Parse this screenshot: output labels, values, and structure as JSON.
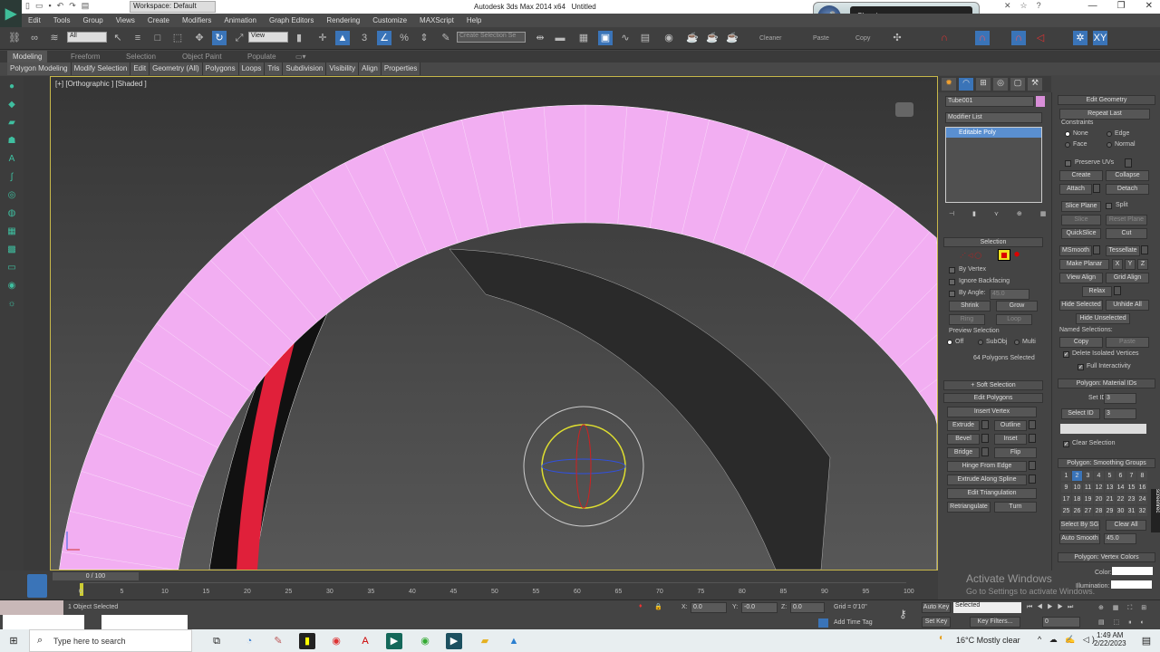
{
  "title_bar": {
    "app_title": "Autodesk 3ds Max  2014 x64",
    "doc": "Untitled",
    "workspace": "Workspace: Default"
  },
  "speech": {
    "status": "Sleeping"
  },
  "menu": [
    "Edit",
    "Tools",
    "Group",
    "Views",
    "Create",
    "Modifiers",
    "Animation",
    "Graph Editors",
    "Rendering",
    "Customize",
    "MAXScript",
    "Help"
  ],
  "toolbar": {
    "filter": "All",
    "ref_coord": "View",
    "snap_angle": "3",
    "named_sel": "Create Selection Se",
    "cleaner": "Cleaner",
    "paste": "Paste",
    "copy": "Copy"
  },
  "ribbon_tabs": [
    "Modeling",
    "Freeform",
    "Selection",
    "Object Paint",
    "Populate"
  ],
  "ribbon_items": [
    "Polygon Modeling",
    "Modify Selection",
    "Edit",
    "Geometry (All)",
    "Polygons",
    "Loops",
    "Tris",
    "Subdivision",
    "Visibility",
    "Align",
    "Properties"
  ],
  "viewport": {
    "label": "[+] [Orthographic ] [Shaded ]",
    "object_color": "#f2aef2"
  },
  "modify_panel": {
    "object_name": "Tube001",
    "modifier_list": "Modifier List",
    "stack_item": "Editable Poly",
    "selection": {
      "title": "Selection",
      "by_vertex": "By Vertex",
      "ignore_backfacing": "Ignore Backfacing",
      "by_angle": "By Angle:",
      "angle": "45.0",
      "shrink": "Shrink",
      "grow": "Grow",
      "ring": "Ring",
      "loop": "Loop",
      "preview": "Preview Selection",
      "off": "Off",
      "subobj": "SubObj",
      "multi": "Multi",
      "count": "64 Polygons Selected"
    },
    "soft_selection": "Soft Selection",
    "edit_polygons": {
      "title": "Edit Polygons",
      "insert_vertex": "Insert Vertex",
      "extrude": "Extrude",
      "outline": "Outline",
      "bevel": "Bevel",
      "inset": "Inset",
      "bridge": "Bridge",
      "flip": "Flip",
      "hinge": "Hinge From Edge",
      "extrude_spline": "Extrude Along Spline",
      "edit_tri": "Edit Triangulation",
      "retri": "Retriangulate",
      "turn": "Turn"
    },
    "edit_geometry": {
      "title": "Edit Geometry",
      "repeat_last": "Repeat Last",
      "constraints": "Constraints",
      "none": "None",
      "edge": "Edge",
      "face": "Face",
      "normal": "Normal",
      "preserve_uvs": "Preserve UVs",
      "create": "Create",
      "collapse": "Collapse",
      "attach": "Attach",
      "detach": "Detach",
      "slice_plane": "Slice Plane",
      "split": "Split",
      "slice": "Slice",
      "reset_plane": "Reset Plane",
      "quickslice": "QuickSlice",
      "cut": "Cut",
      "msmooth": "MSmooth",
      "tessellate": "Tessellate",
      "make_planar": "Make Planar",
      "x": "X",
      "y": "Y",
      "z": "Z",
      "view_align": "View Align",
      "grid_align": "Grid Align",
      "relax": "Relax",
      "hide_selected": "Hide Selected",
      "unhide_all": "Unhide All",
      "hide_unselected": "Hide Unselected",
      "named_selections": "Named Selections:",
      "copy": "Copy",
      "paste": "Paste",
      "delete_isolated": "Delete Isolated Vertices",
      "full_interactivity": "Full Interactivity"
    },
    "material_ids": {
      "title": "Polygon: Material IDs",
      "set_id_label": "Set ID:",
      "set_id": "3",
      "select_id": "Select ID",
      "select_id_value": "3",
      "clear_selection": "Clear Selection"
    },
    "smoothing": {
      "title": "Polygon: Smoothing Groups",
      "groups": [
        "1",
        "2",
        "3",
        "4",
        "5",
        "6",
        "7",
        "8",
        "9",
        "10",
        "11",
        "12",
        "13",
        "14",
        "15",
        "16",
        "17",
        "18",
        "19",
        "20",
        "21",
        "22",
        "23",
        "24",
        "25",
        "26",
        "27",
        "28",
        "29",
        "30",
        "31",
        "32"
      ],
      "active": 2,
      "select_by_sg": "Select By SG",
      "clear_all": "Clear All",
      "auto_smooth": "Auto Smooth",
      "auto_smooth_value": "45.0"
    },
    "vertex_colors": {
      "title": "Polygon: Vertex Colors",
      "color": "Color:",
      "illumination": "Illumination:"
    }
  },
  "timeline": {
    "frame": "0 / 100",
    "ticks": [
      "0",
      "5",
      "10",
      "15",
      "20",
      "25",
      "30",
      "35",
      "40",
      "45",
      "50",
      "55",
      "60",
      "65",
      "70",
      "75",
      "80",
      "85",
      "90",
      "95",
      "100"
    ]
  },
  "status": {
    "selected": "1 Object Selected",
    "x_label": "X:",
    "x": "0.0",
    "y_label": "Y:",
    "y": "-0.0",
    "z_label": "Z:",
    "z": "0.0",
    "grid": "Grid = 0'10\"",
    "add_time_tag": "Add Time Tag",
    "auto_key": "Auto Key",
    "set_key": "Set Key",
    "key_mode": "Selected",
    "key_filters": "Key Filters...",
    "frame_value": "0"
  },
  "watermark": {
    "line1": "Activate Windows",
    "line2": "Go to Settings to activate Windows."
  },
  "screenrec": "screenrec",
  "taskbar": {
    "search": "Type here to search",
    "weather": "16°C  Mostly clear",
    "time": "1:49 AM",
    "date": "2/22/2023"
  }
}
